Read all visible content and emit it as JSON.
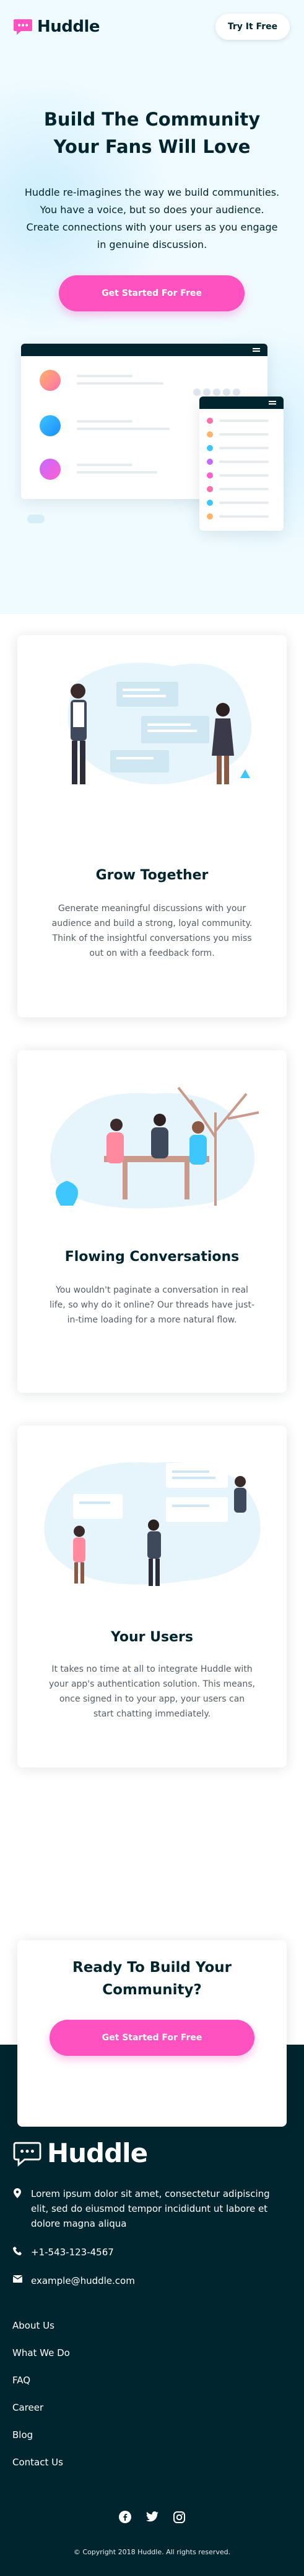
{
  "header": {
    "brand": "Huddle",
    "try_button": "Try It Free"
  },
  "hero": {
    "title": "Build The Community Your Fans Will Love",
    "text": "Huddle re-imagines the way we build communities. You have a voice, but so does your audience. Create connections with your users as you engage in genuine discussion.",
    "cta": "Get Started For Free"
  },
  "features": [
    {
      "title": "Grow Together",
      "text": "Generate meaningful discussions with your audience and build a strong, loyal community. Think of the insightful conversations you miss out on with a feedback form."
    },
    {
      "title": "Flowing Conversations",
      "text": "You wouldn't paginate a conversation in real life, so why do it online? Our threads have just-in-time loading for a more natural flow."
    },
    {
      "title": "Your Users",
      "text": "It takes no time at all to integrate Huddle with your app's authentication solution. This means, once signed in to your app, your users can start chatting immediately."
    }
  ],
  "ready": {
    "title": "Ready To Build Your Community?",
    "cta": "Get Started For Free"
  },
  "footer": {
    "brand": "Huddle",
    "address": "Lorem ipsum dolor sit amet, consectetur adipiscing elit, sed do eiusmod tempor incididunt ut labore et dolore magna aliqua",
    "phone": "+1-543-123-4567",
    "email": "example@huddle.com",
    "links": [
      "About Us",
      "What We Do",
      "FAQ",
      "Career",
      "Blog",
      "Contact Us"
    ],
    "social": [
      "facebook-icon",
      "twitter-icon",
      "instagram-icon"
    ],
    "copyright": "© Copyright 2018 Huddle. All rights reserved."
  },
  "colors": {
    "dark": "#00252e",
    "pink": "#ff52c1",
    "hero_bg": "#f0fbff",
    "text_muted": "#555e66"
  }
}
